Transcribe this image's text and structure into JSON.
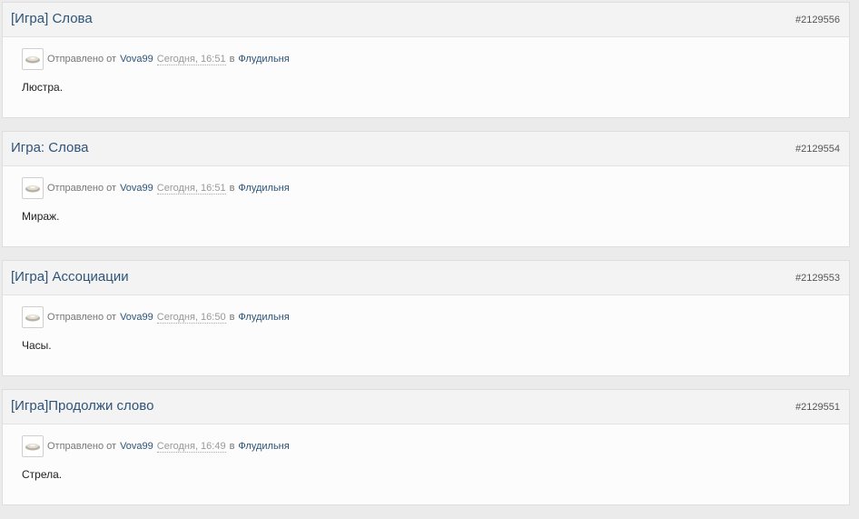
{
  "posts": [
    {
      "title": "[Игра] Слова",
      "id": "#2129556",
      "sent_label": "Отправлено от",
      "author": "Vova99",
      "date": "Сегодня, 16:51",
      "in_label": "в",
      "forum": "Флудильня",
      "text": "Люстра."
    },
    {
      "title": "Игра: Слова",
      "id": "#2129554",
      "sent_label": "Отправлено от",
      "author": "Vova99",
      "date": "Сегодня, 16:51",
      "in_label": "в",
      "forum": "Флудильня",
      "text": "Мираж."
    },
    {
      "title": "[Игра] Ассоциации",
      "id": "#2129553",
      "sent_label": "Отправлено от",
      "author": "Vova99",
      "date": "Сегодня, 16:50",
      "in_label": "в",
      "forum": "Флудильня",
      "text": "Часы."
    },
    {
      "title": "[Игра]Продолжи слово",
      "id": "#2129551",
      "sent_label": "Отправлено от",
      "author": "Vova99",
      "date": "Сегодня, 16:49",
      "in_label": "в",
      "forum": "Флудильня",
      "text": "Стрела."
    }
  ],
  "colors": {
    "link": "#2e5478",
    "background": "#ebebeb",
    "header": "#f3f3f3"
  }
}
